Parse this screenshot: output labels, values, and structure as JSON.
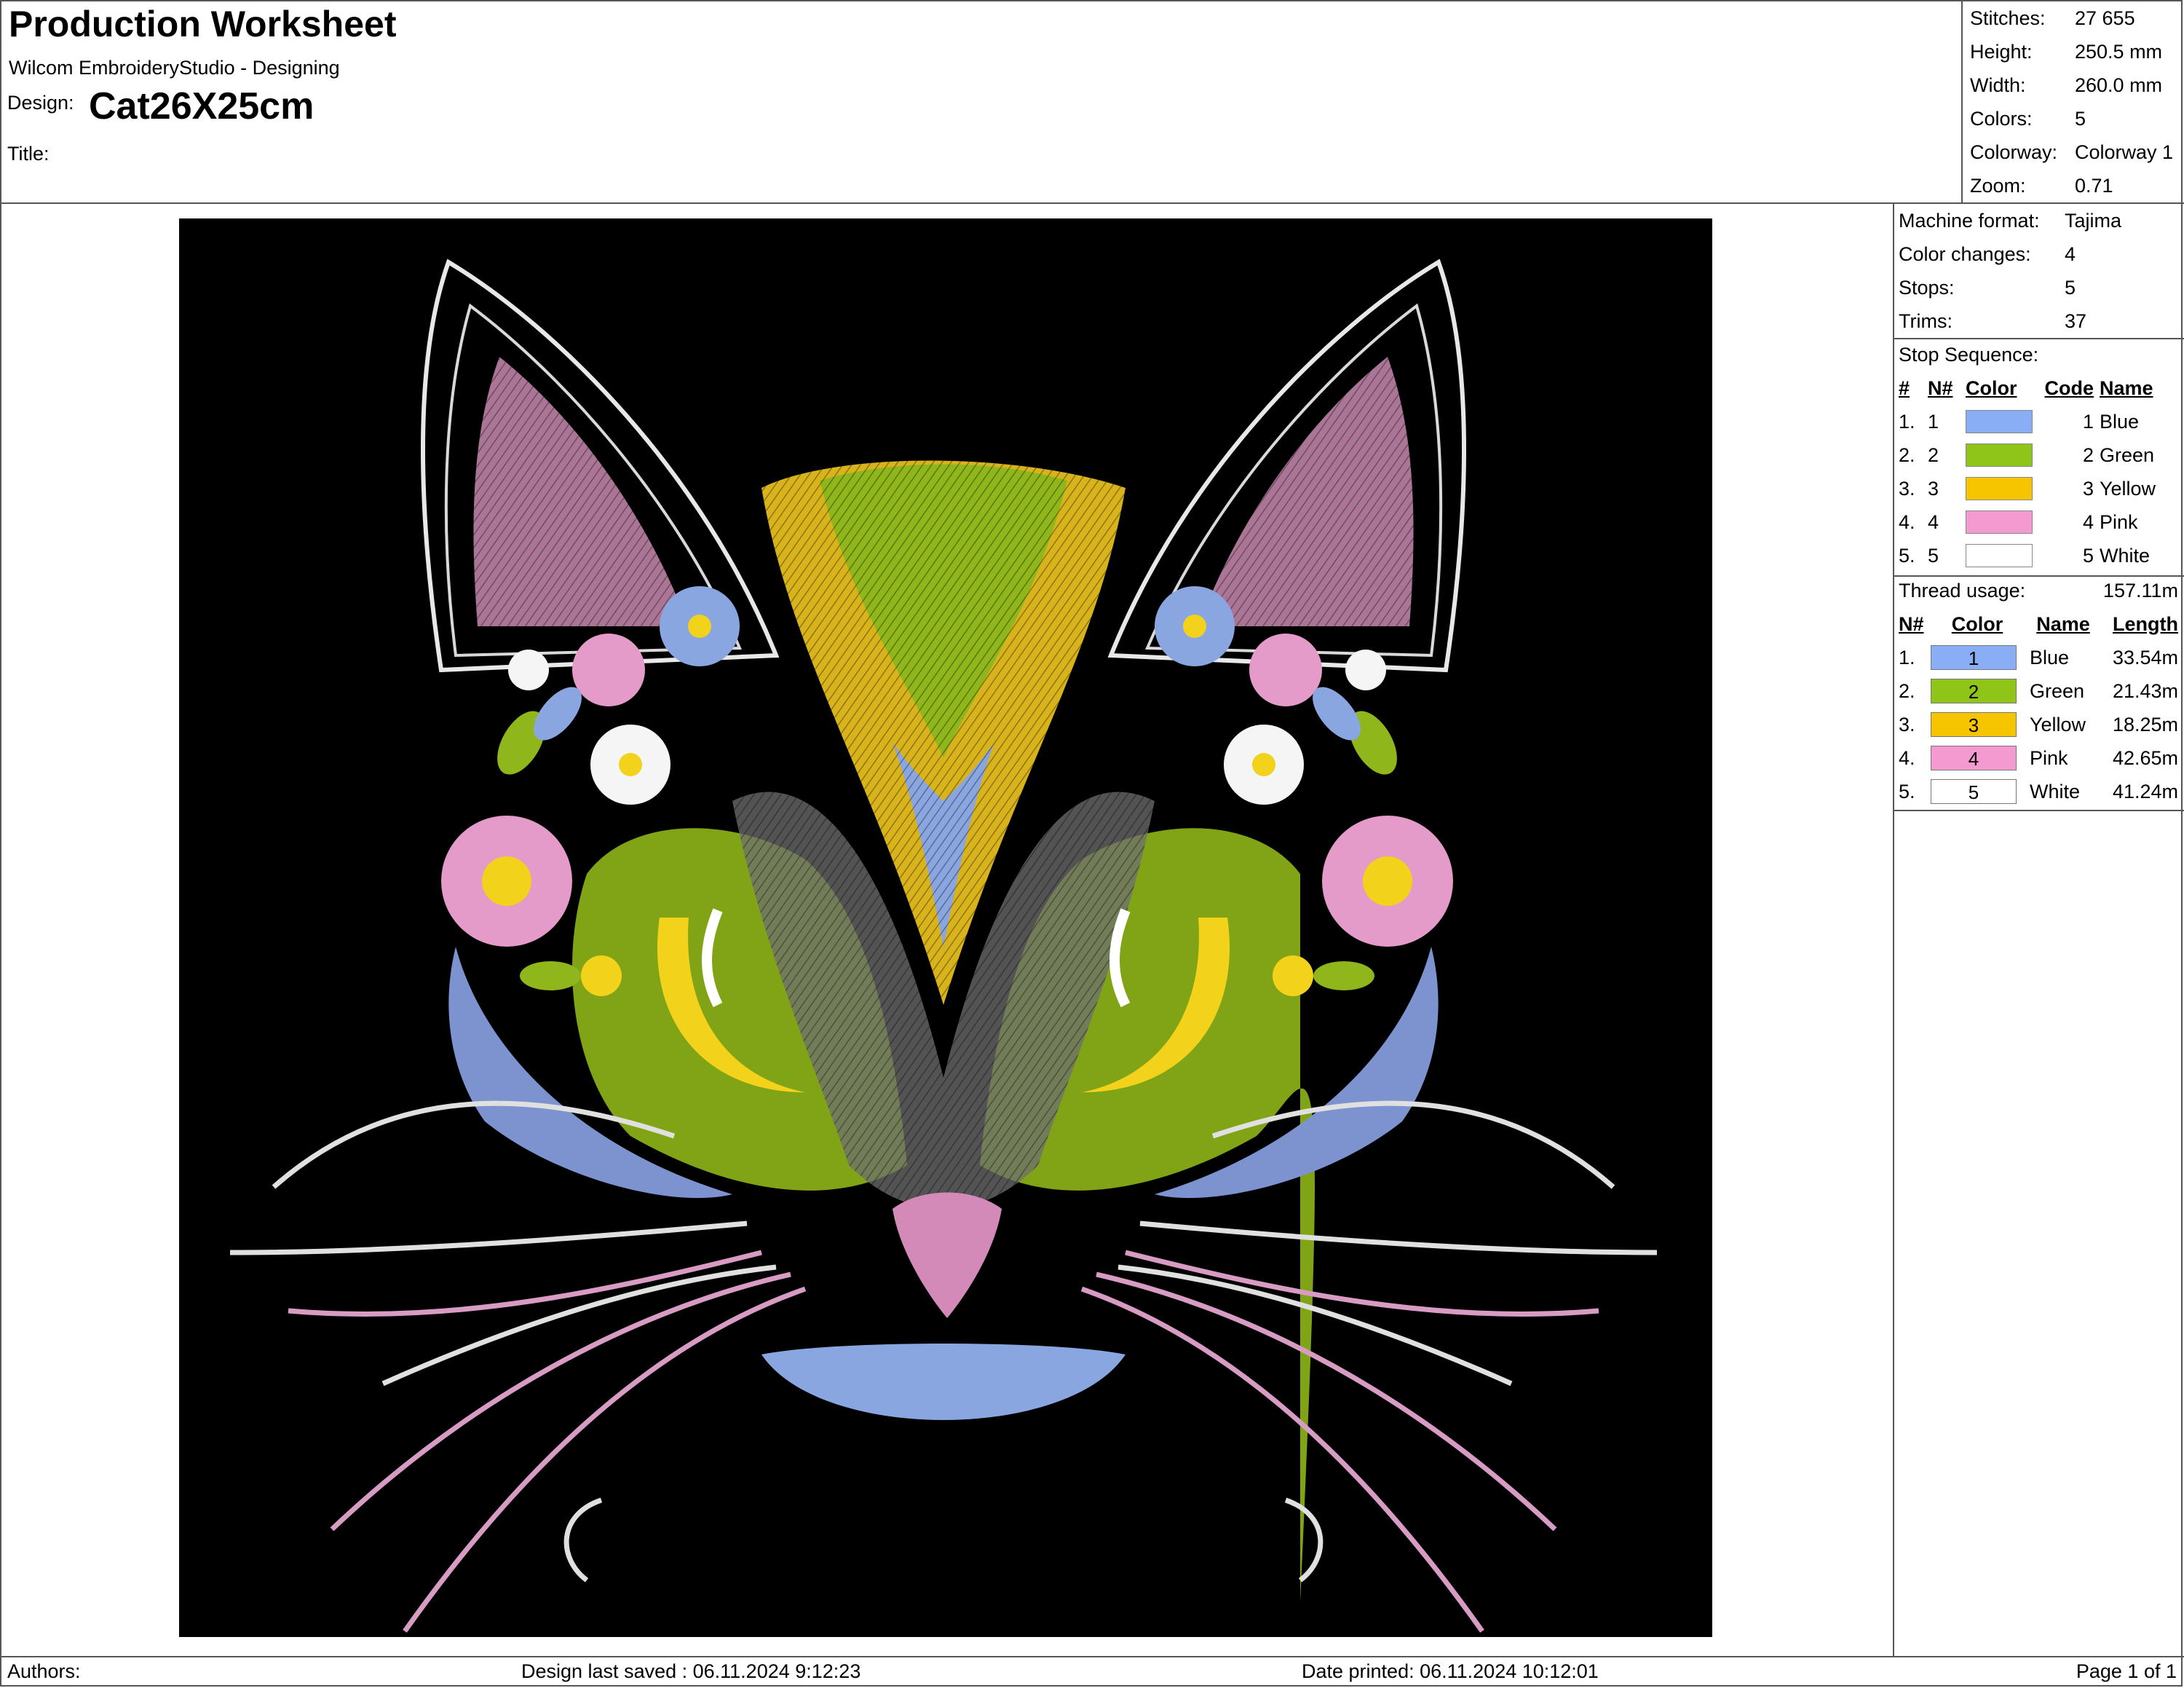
{
  "header": {
    "title": "Production Worksheet",
    "software": "Wilcom EmbroideryStudio - Designing",
    "design_label": "Design:",
    "design_name": "Cat26X25cm",
    "title_label": "Title:",
    "title_value": ""
  },
  "summary": [
    {
      "label": "Stitches:",
      "value": "27 655"
    },
    {
      "label": "Height:",
      "value": "250.5 mm"
    },
    {
      "label": "Width:",
      "value": "260.0 mm"
    },
    {
      "label": "Colors:",
      "value": "5"
    },
    {
      "label": "Colorway:",
      "value": "Colorway 1"
    },
    {
      "label": "Zoom:",
      "value": "0.71"
    }
  ],
  "machine": [
    {
      "label": "Machine format:",
      "value": "Tajima"
    },
    {
      "label": "Color changes:",
      "value": "4"
    },
    {
      "label": "Stops:",
      "value": "5"
    },
    {
      "label": "Trims:",
      "value": "37"
    }
  ],
  "stop_sequence": {
    "label": "Stop Sequence:",
    "headers": [
      "#",
      "N#",
      "Color",
      "Code",
      "Name"
    ],
    "rows": [
      {
        "num": "1.",
        "n": "1",
        "color": "#8aaef5",
        "code": "1",
        "name": "Blue"
      },
      {
        "num": "2.",
        "n": "2",
        "color": "#8fc418",
        "code": "2",
        "name": "Green"
      },
      {
        "num": "3.",
        "n": "3",
        "color": "#f7c500",
        "code": "3",
        "name": "Yellow"
      },
      {
        "num": "4.",
        "n": "4",
        "color": "#f59ad0",
        "code": "4",
        "name": "Pink"
      },
      {
        "num": "5.",
        "n": "5",
        "color": "#ffffff",
        "code": "5",
        "name": "White"
      }
    ]
  },
  "thread_usage": {
    "label": "Thread usage:",
    "total": "157.11m",
    "headers": [
      "N#",
      "Color",
      "Name",
      "Length"
    ],
    "rows": [
      {
        "num": "1.",
        "color": "#8aaef5",
        "code": "1",
        "name": "Blue",
        "length": "33.54m"
      },
      {
        "num": "2.",
        "color": "#8fc418",
        "code": "2",
        "name": "Green",
        "length": "21.43m"
      },
      {
        "num": "3.",
        "color": "#f7c500",
        "code": "3",
        "name": "Yellow",
        "length": "18.25m"
      },
      {
        "num": "4.",
        "color": "#f59ad0",
        "code": "4",
        "name": "Pink",
        "length": "42.65m"
      },
      {
        "num": "5.",
        "color": "#ffffff",
        "code": "5",
        "name": "White",
        "length": "41.24m"
      }
    ]
  },
  "footer": {
    "authors": "Authors:",
    "saved": "Design last saved : 06.11.2024 9:12:23",
    "printed": "Date printed: 06.11.2024 10:12:01",
    "page": "Page 1 of 1"
  },
  "design_preview": {
    "background": "#000000",
    "subject": "cat-face-embroidery"
  }
}
